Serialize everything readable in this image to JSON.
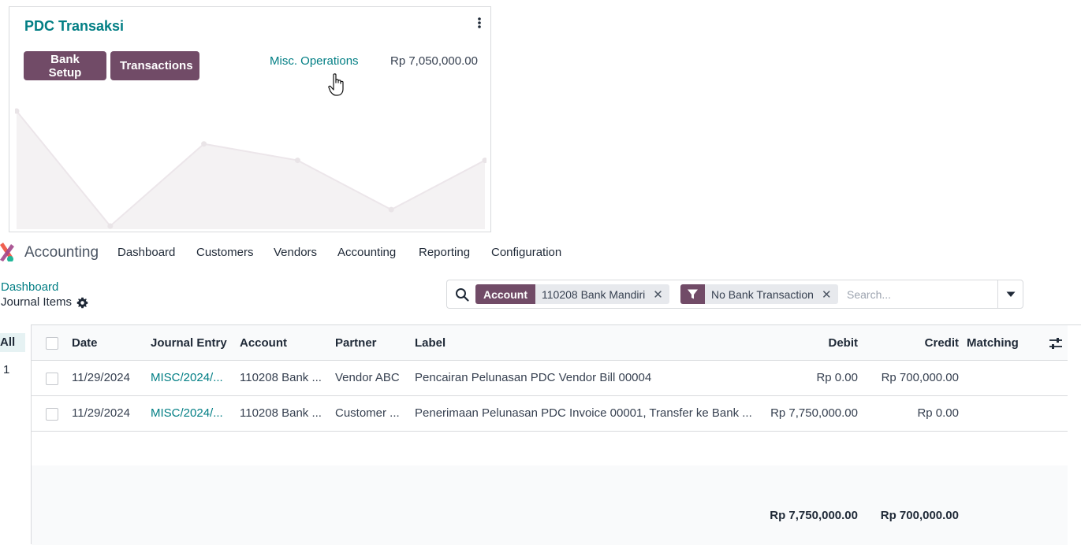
{
  "card": {
    "title": "PDC Transaksi",
    "buttons": {
      "bank_setup": "Bank Setup",
      "transactions": "Transactions"
    },
    "misc_link": "Misc. Operations",
    "balance": "Rp 7,050,000.00",
    "chart_values": [
      8,
      1,
      6,
      5,
      2,
      5
    ]
  },
  "app": {
    "name": "Accounting"
  },
  "nav": [
    "Dashboard",
    "Customers",
    "Vendors",
    "Accounting",
    "Reporting",
    "Configuration"
  ],
  "breadcrumb": "Dashboard",
  "page_title": "Journal Items",
  "search": {
    "facet1": {
      "label": "Account",
      "value": "110208 Bank Mandiri"
    },
    "facet2": {
      "value": "No Bank Transaction"
    },
    "placeholder": "Search..."
  },
  "sidebar": {
    "all_label": "All",
    "count": "1"
  },
  "table": {
    "headers": {
      "date": "Date",
      "journal_entry": "Journal Entry",
      "account": "Account",
      "partner": "Partner",
      "label": "Label",
      "debit": "Debit",
      "credit": "Credit",
      "matching": "Matching"
    },
    "rows": [
      {
        "date": "11/29/2024",
        "journal_entry": "MISC/2024/...",
        "account": "110208 Bank ...",
        "partner": "Vendor ABC",
        "label": "Pencairan Pelunasan PDC Vendor Bill 00004",
        "debit": "Rp 0.00",
        "credit": "Rp 700,000.00"
      },
      {
        "date": "11/29/2024",
        "journal_entry": "MISC/2024/...",
        "account": "110208 Bank ...",
        "partner": "Customer ...",
        "label": "Penerimaan Pelunasan PDC Invoice 00001, Transfer ke Bank ...",
        "debit": "Rp 7,750,000.00",
        "credit": "Rp 0.00"
      }
    ],
    "totals": {
      "debit": "Rp 7,750,000.00",
      "credit": "Rp 700,000.00"
    }
  },
  "colors": {
    "primary": "#714b67",
    "link": "#017e84"
  }
}
